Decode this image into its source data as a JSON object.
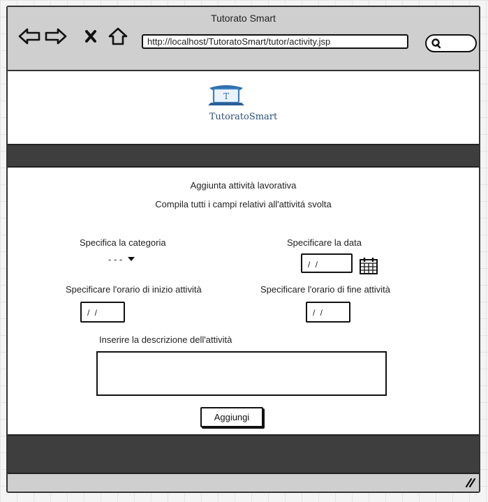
{
  "browser": {
    "title": "Tutorato Smart",
    "url": "http://localhost/TutoratoSmart/tutor/activity.jsp",
    "icons": [
      "back-arrow-icon",
      "forward-arrow-icon",
      "close-icon",
      "home-icon",
      "search-icon"
    ]
  },
  "header": {
    "logo_mark": "T",
    "logo_text": "TutoratoSmart"
  },
  "form": {
    "title": "Aggiunta attività lavorativa",
    "subtitle": "Compila tutti i campi relativi all'attivitá svolta",
    "category": {
      "label": "Specifica la categoria",
      "value": "- - -"
    },
    "date": {
      "label": "Specificare la data",
      "value": "/ /"
    },
    "start_time": {
      "label": "Specificare l'orario di inizio attività",
      "value": "/ /"
    },
    "end_time": {
      "label": "Specificare l'orario di fine attività",
      "value": "/ /"
    },
    "description": {
      "label": "Inserire la descrizione dell'attività",
      "value": ""
    },
    "submit_label": "Aggiungi"
  }
}
